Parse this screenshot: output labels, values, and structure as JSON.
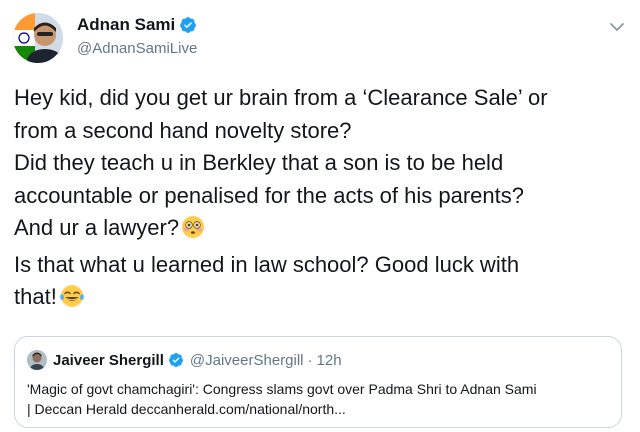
{
  "tweet": {
    "author_name": "Adnan Sami",
    "author_handle": "@AdnanSamiLive",
    "lines": [
      "Hey kid, did you get ur brain from a ‘Clearance Sale’ or",
      "from a second hand novelty store?",
      "Did they teach u in Berkley that a son is to be held",
      "accountable or penalised for the acts of his parents?",
      "And ur a lawyer?",
      "Is that what u learned in law school? Good luck with",
      "that!"
    ],
    "emojis": [
      "flushed-face-emoji",
      "tears-of-joy-emoji"
    ]
  },
  "quote": {
    "author_name": "Jaiveer Shergill",
    "author_handle": "@JaiveerShergill",
    "separator": "·",
    "time": "12h",
    "lines": [
      "'Magic of govt chamchagiri': Congress slams govt over Padma Shri to Adnan Sami",
      "| Deccan Herald deccanherald.com/national/north..."
    ]
  },
  "colors": {
    "text": "#14171a",
    "secondary": "#657786",
    "verified": "#1da1f2",
    "border": "#ccd6dd"
  },
  "icons": {
    "verified": "verified-badge-icon",
    "menu": "chevron-down-icon"
  }
}
